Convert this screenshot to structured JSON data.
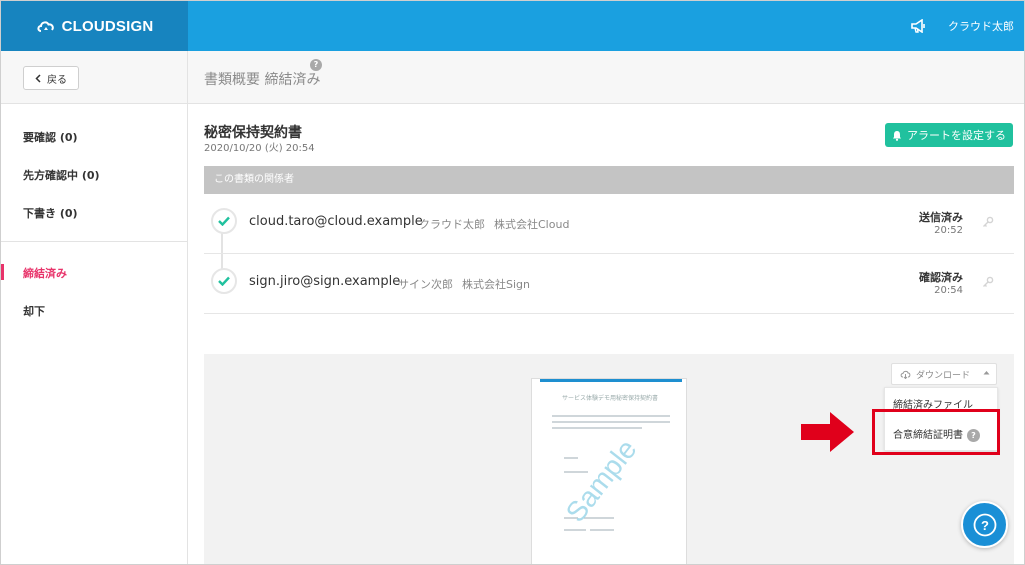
{
  "header": {
    "brand": "CLOUDSIGN",
    "user_name": "クラウド太郎",
    "colors": {
      "header_bg": "#1aa0e0",
      "logo_bg": "#1784bf"
    }
  },
  "subheader": {
    "back_label": "戻る",
    "page_title": "書類概要 締結済み",
    "help_mark": "?"
  },
  "sidebar": {
    "items": [
      {
        "label": "要確認",
        "count": "(0)"
      },
      {
        "label": "先方確認中",
        "count": "(0)"
      },
      {
        "label": "下書き",
        "count": "(0)"
      },
      {
        "label": "締結済み",
        "active": true
      },
      {
        "label": "却下"
      }
    ],
    "active_color": "#e8336a"
  },
  "document": {
    "title": "秘密保持契約書",
    "date": "2020/10/20 (火) 20:54",
    "alert_button": "アラートを設定する",
    "alert_color": "#20c19e"
  },
  "parties_section": {
    "header": "この書類の関係者",
    "parties": [
      {
        "email": "cloud.taro@cloud.example",
        "name": "クラウド太郎",
        "company": "株式会社Cloud",
        "status": "送信済み",
        "time": "20:52"
      },
      {
        "email": "sign.jiro@sign.example",
        "name": "サイン次郎",
        "company": "株式会社Sign",
        "status": "確認済み",
        "time": "20:54"
      }
    ]
  },
  "preview": {
    "thumbnail_title": "サービス体験デモ用秘密保持契約書",
    "watermark": "Sample",
    "download_button": "ダウンロード",
    "download_menu": [
      {
        "label": "締結済みファイル"
      },
      {
        "label": "合意締結証明書",
        "help": "?"
      }
    ]
  },
  "help_fab": "?"
}
